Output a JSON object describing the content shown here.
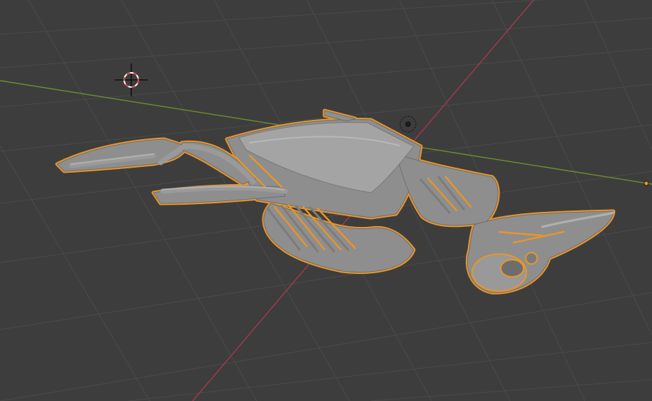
{
  "viewport": {
    "kind": "3d-viewport",
    "colors": {
      "background": "#3d3d3d",
      "grid": "#4a4a4a",
      "x_axis": "#a6394a",
      "y_axis": "#6e8f2c",
      "selection_outline": "#e8952a",
      "mesh": "#8e8e8e",
      "mesh_shadow": "#6f6f6f",
      "mesh_highlight": "#b2b2b2"
    }
  },
  "scene": {
    "objects": [
      {
        "name": "skeleton-mesh",
        "selected": true
      },
      {
        "name": "3d-cursor"
      },
      {
        "name": "object-origin"
      },
      {
        "name": "light-gizmo"
      }
    ]
  }
}
